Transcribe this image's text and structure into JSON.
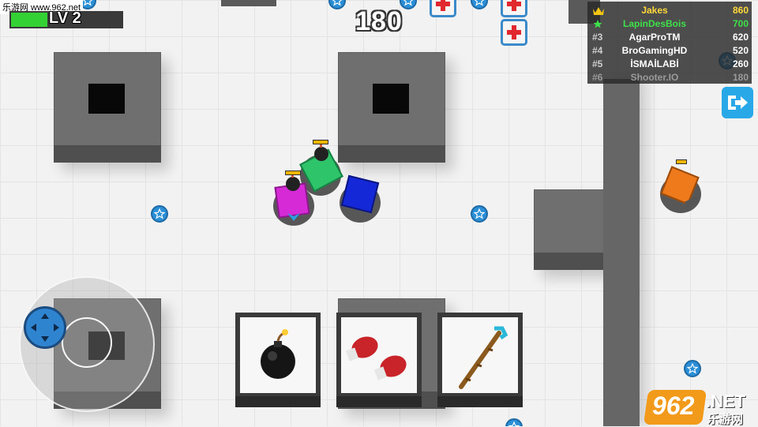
{
  "watermark": {
    "top_left": "乐游网 www.962.net",
    "brand_number": "962",
    "brand_suffix": ".NET",
    "brand_cn": "乐游网"
  },
  "hud": {
    "level_label": "LV 2",
    "xp_progress": 0.33,
    "score": "180",
    "xp_color": "#34d134"
  },
  "leaderboard": {
    "rows": [
      {
        "rank_icon": "crown-icon",
        "rank": "",
        "name": "Jakes",
        "score": "860",
        "name_color": "#ffd83a"
      },
      {
        "rank_icon": "star-icon",
        "rank": "",
        "name": "LapinDesBois",
        "score": "700",
        "name_color": "#3fe04a"
      },
      {
        "rank_icon": "",
        "rank": "#3",
        "name": "AgarProTM",
        "score": "620",
        "name_color": "#ffffff"
      },
      {
        "rank_icon": "",
        "rank": "#4",
        "name": "BroGamingHD",
        "score": "520",
        "name_color": "#ffffff"
      },
      {
        "rank_icon": "",
        "rank": "#5",
        "name": "İSMAİLABİ",
        "score": "260",
        "name_color": "#ffffff"
      },
      {
        "rank_icon": "",
        "rank": "#6",
        "name": "Shooter.IO",
        "score": "180",
        "name_color": "#9a9a9a"
      }
    ]
  },
  "controls": {
    "exit_icon": "exit-icon",
    "joystick_icon": "dpad-icon"
  },
  "weapons": [
    {
      "name": "bomb",
      "icon": "bomb-icon"
    },
    {
      "name": "boxing gloves",
      "icon": "boxing-gloves-icon"
    },
    {
      "name": "staff",
      "icon": "staff-icon"
    }
  ],
  "players": [
    {
      "color": "#2ec46a",
      "accent": "#f2b600"
    },
    {
      "color": "#d62ad6",
      "accent": "#f2b600"
    },
    {
      "color": "#1428d8",
      "accent": ""
    },
    {
      "color": "#ee7a1c",
      "accent": "#f2b600"
    }
  ]
}
